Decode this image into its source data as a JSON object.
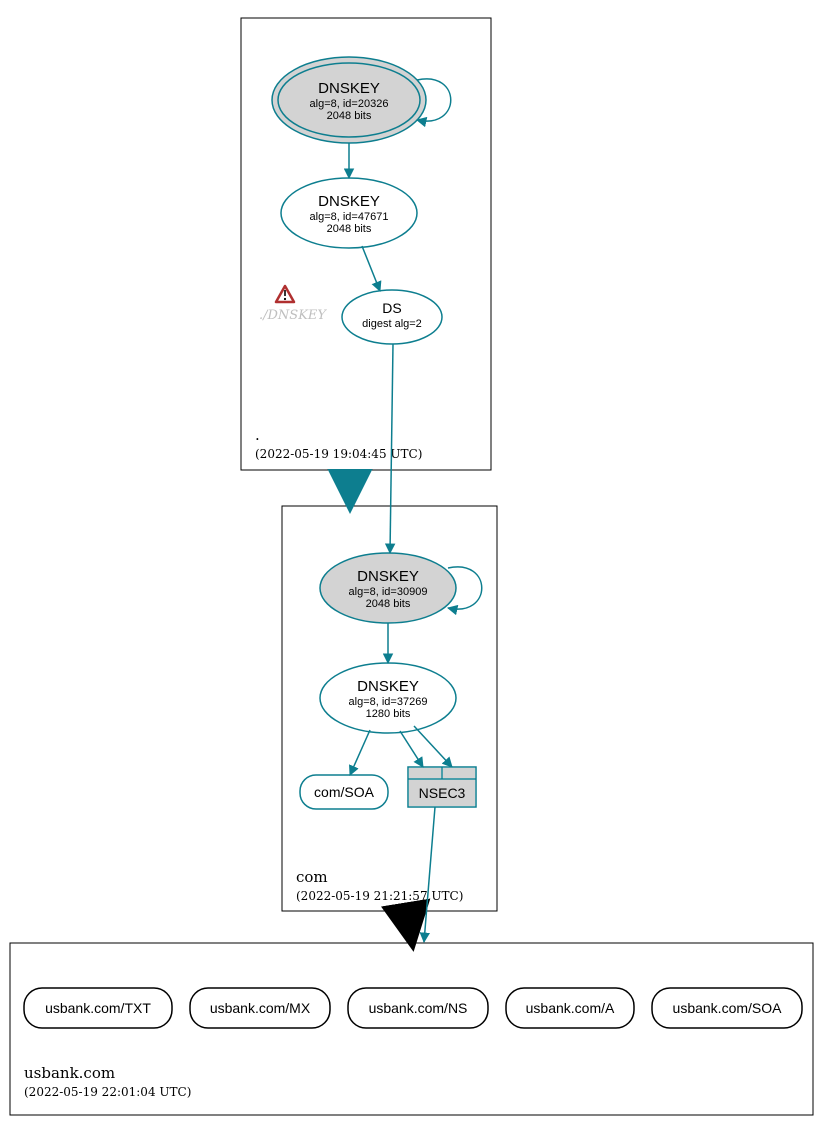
{
  "zones": {
    "root": {
      "name": ".",
      "time": "(2022-05-19 19:04:45 UTC)"
    },
    "com": {
      "name": "com",
      "time": "(2022-05-19 21:21:57 UTC)"
    },
    "usbank": {
      "name": "usbank.com",
      "time": "(2022-05-19 22:01:04 UTC)"
    }
  },
  "nodes": {
    "root_ksk": {
      "title": "DNSKEY",
      "sub1": "alg=8, id=20326",
      "sub2": "2048 bits"
    },
    "root_zsk": {
      "title": "DNSKEY",
      "sub1": "alg=8, id=47671",
      "sub2": "2048 bits"
    },
    "root_ds": {
      "title": "DS",
      "sub1": "digest alg=2"
    },
    "root_ghost": {
      "label": "./DNSKEY"
    },
    "com_ksk": {
      "title": "DNSKEY",
      "sub1": "alg=8, id=30909",
      "sub2": "2048 bits"
    },
    "com_zsk": {
      "title": "DNSKEY",
      "sub1": "alg=8, id=37269",
      "sub2": "1280 bits"
    },
    "com_soa": {
      "label": "com/SOA"
    },
    "com_nsec3": {
      "label": "NSEC3"
    },
    "usbank_txt": {
      "label": "usbank.com/TXT"
    },
    "usbank_mx": {
      "label": "usbank.com/MX"
    },
    "usbank_ns": {
      "label": "usbank.com/NS"
    },
    "usbank_a": {
      "label": "usbank.com/A"
    },
    "usbank_soa": {
      "label": "usbank.com/SOA"
    }
  },
  "style": {
    "teal": "#0d7e8f",
    "zone_stroke": "#000",
    "node_fill_sep": "#d3d3d3",
    "nsec3_fill": "#d3d3d3"
  }
}
